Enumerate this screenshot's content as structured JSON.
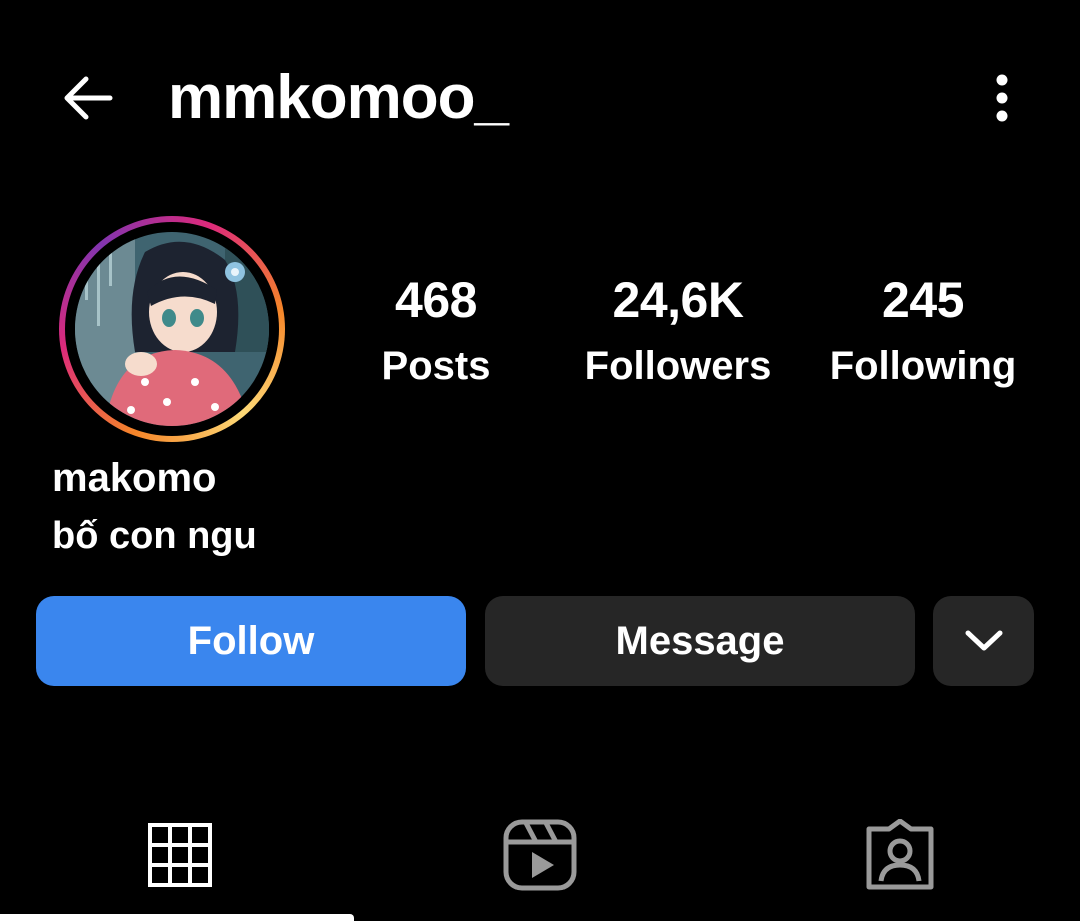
{
  "header": {
    "username": "mmkomoo_",
    "back_icon": "arrow-left-icon",
    "more_icon": "more-vertical-icon"
  },
  "profile": {
    "display_name": "makomo",
    "bio": "bố con ngu",
    "avatar_ring_colors": [
      "#f58529",
      "#dd2a7b",
      "#8134af"
    ]
  },
  "stats": {
    "posts": {
      "value": "468",
      "label": "Posts"
    },
    "followers": {
      "value": "24,6K",
      "label": "Followers"
    },
    "following": {
      "value": "245",
      "label": "Following"
    }
  },
  "actions": {
    "follow_label": "Follow",
    "message_label": "Message",
    "dropdown_icon": "chevron-down-icon",
    "follow_color": "#3a86ee",
    "secondary_color": "#262626"
  },
  "tabs": [
    {
      "icon": "grid-icon",
      "active": true
    },
    {
      "icon": "reels-icon",
      "active": false
    },
    {
      "icon": "tagged-icon",
      "active": false
    }
  ]
}
